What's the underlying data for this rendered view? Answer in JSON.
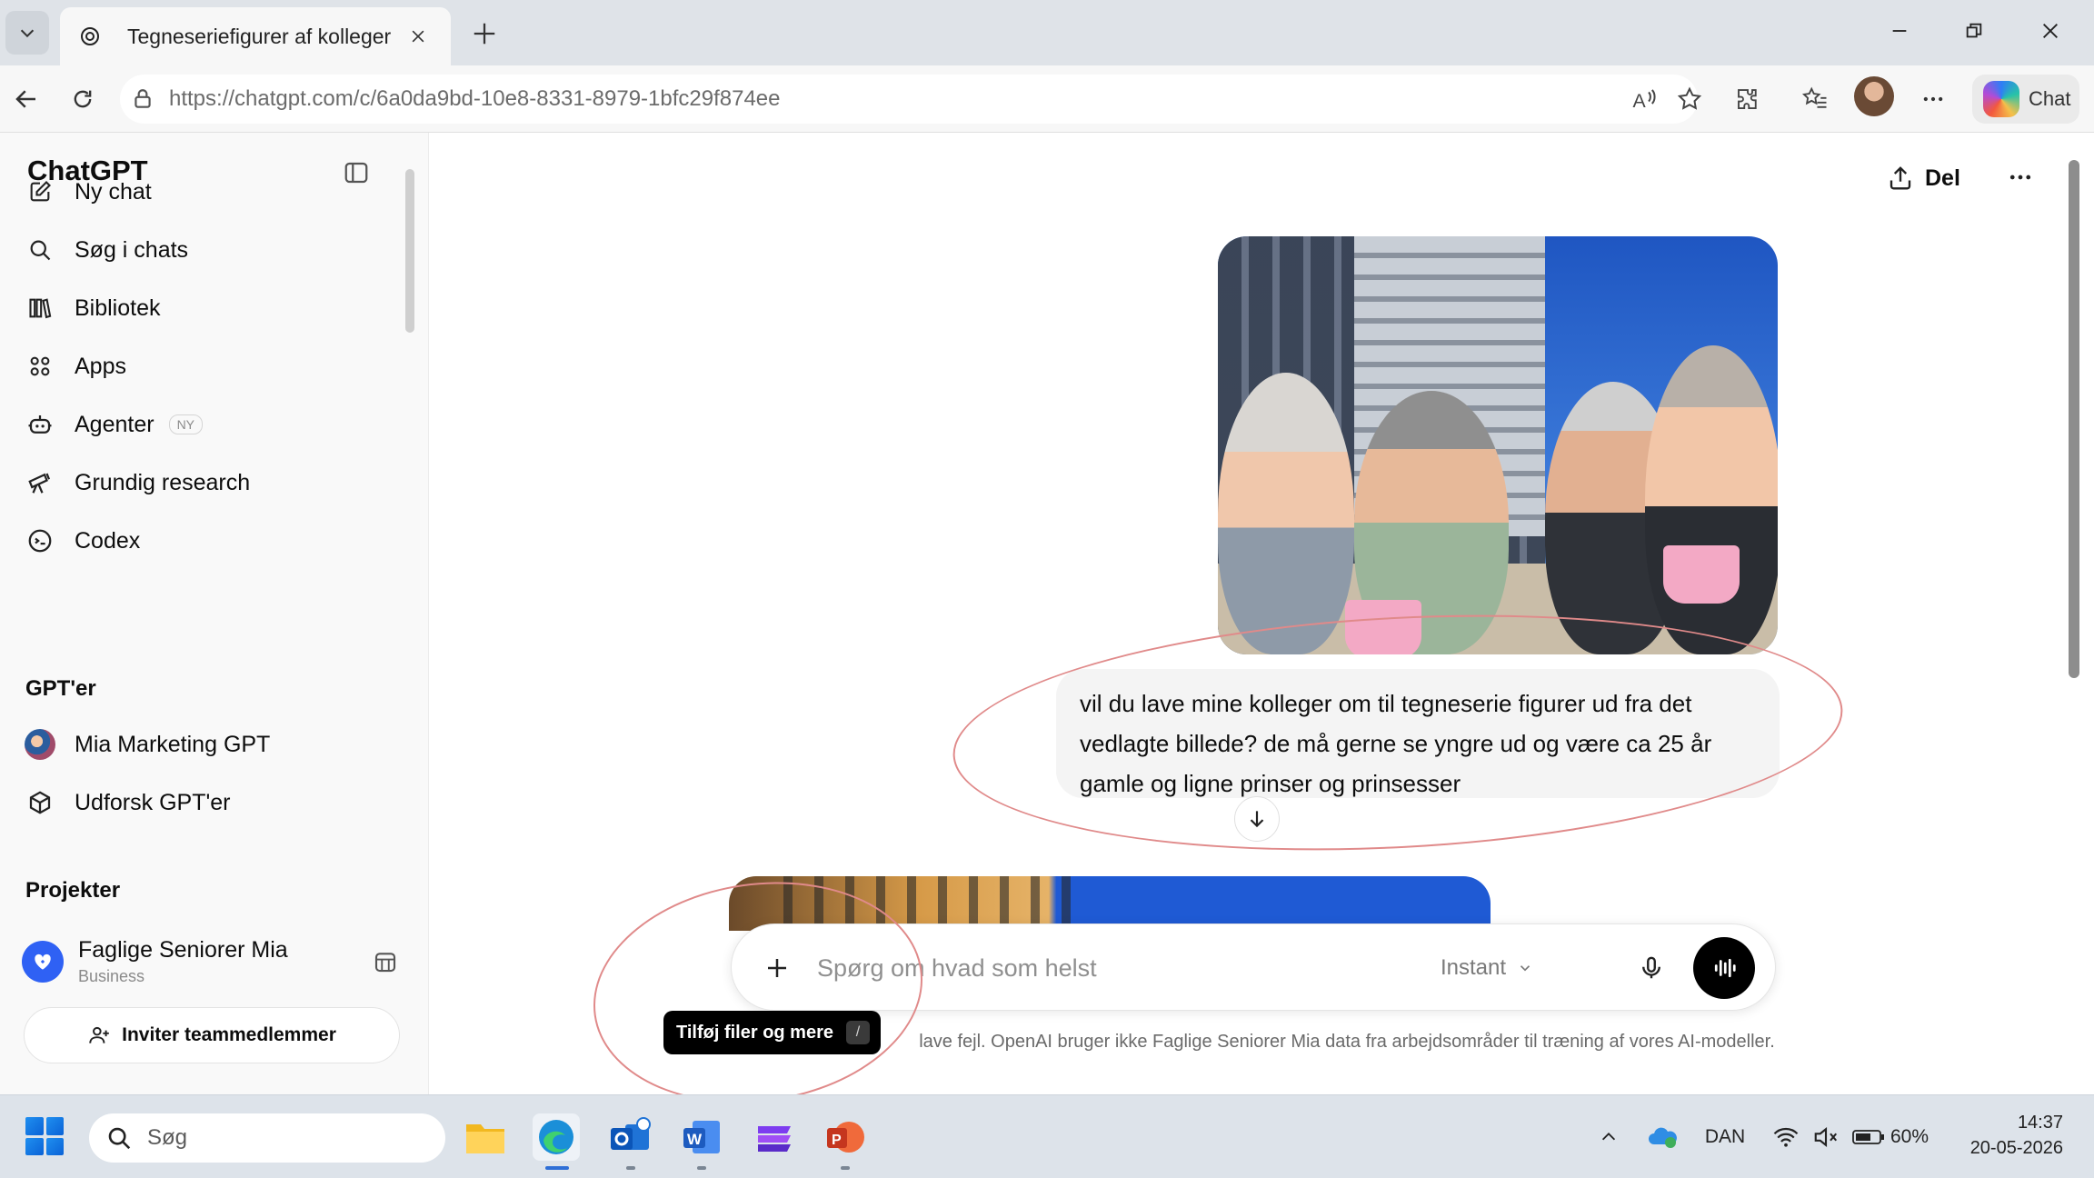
{
  "browser": {
    "tab_title": "Tegneseriefigurer af kolleger",
    "url_domain": "https://chatgpt.com",
    "url_path": "/c/6a0da9bd-10e8-8331-8979-1bfc29f874ee",
    "copilot_label": "Chat"
  },
  "sidebar": {
    "brand": "ChatGPT",
    "nav": [
      {
        "label": "Ny chat",
        "icon": "compose-icon"
      },
      {
        "label": "Søg i chats",
        "icon": "search-icon"
      },
      {
        "label": "Bibliotek",
        "icon": "library-icon"
      },
      {
        "label": "Apps",
        "icon": "apps-grid-icon"
      },
      {
        "label": "Agenter",
        "icon": "agent-icon",
        "badge": "NY"
      },
      {
        "label": "Grundig research",
        "icon": "telescope-icon"
      },
      {
        "label": "Codex",
        "icon": "codex-icon"
      }
    ],
    "gpts_heading": "GPT'er",
    "gpts": [
      {
        "label": "Mia Marketing GPT"
      },
      {
        "label": "Udforsk GPT'er"
      }
    ],
    "projects_heading": "Projekter",
    "project": {
      "name": "Faglige Seniorer Mia",
      "plan": "Business"
    },
    "invite_label": "Inviter teammedlemmer"
  },
  "main": {
    "share_label": "Del",
    "user_message": "vil du lave mine kolleger om til tegneserie figurer ud fra det vedlagte billede? de må gerne se yngre ud og være ca 25 år gamle og ligne prinser og prinsesser",
    "composer": {
      "placeholder": "Spørg om hvad som helst",
      "model": "Instant"
    },
    "tooltip": {
      "label": "Tilføj filer og mere",
      "shortcut": "/"
    },
    "disclaimer": "lave fejl. OpenAI bruger ikke Faglige Seniorer Mia data fra arbejdsområder til træning af vores AI-modeller."
  },
  "taskbar": {
    "search_label": "Søg",
    "language": "DAN",
    "battery": "60%",
    "time": "14:37",
    "date": "20-05-2026"
  },
  "colors": {
    "accent_blue": "#2f61f4",
    "annotation_red": "#e08a8a",
    "bubble_bg": "#f4f4f4"
  }
}
